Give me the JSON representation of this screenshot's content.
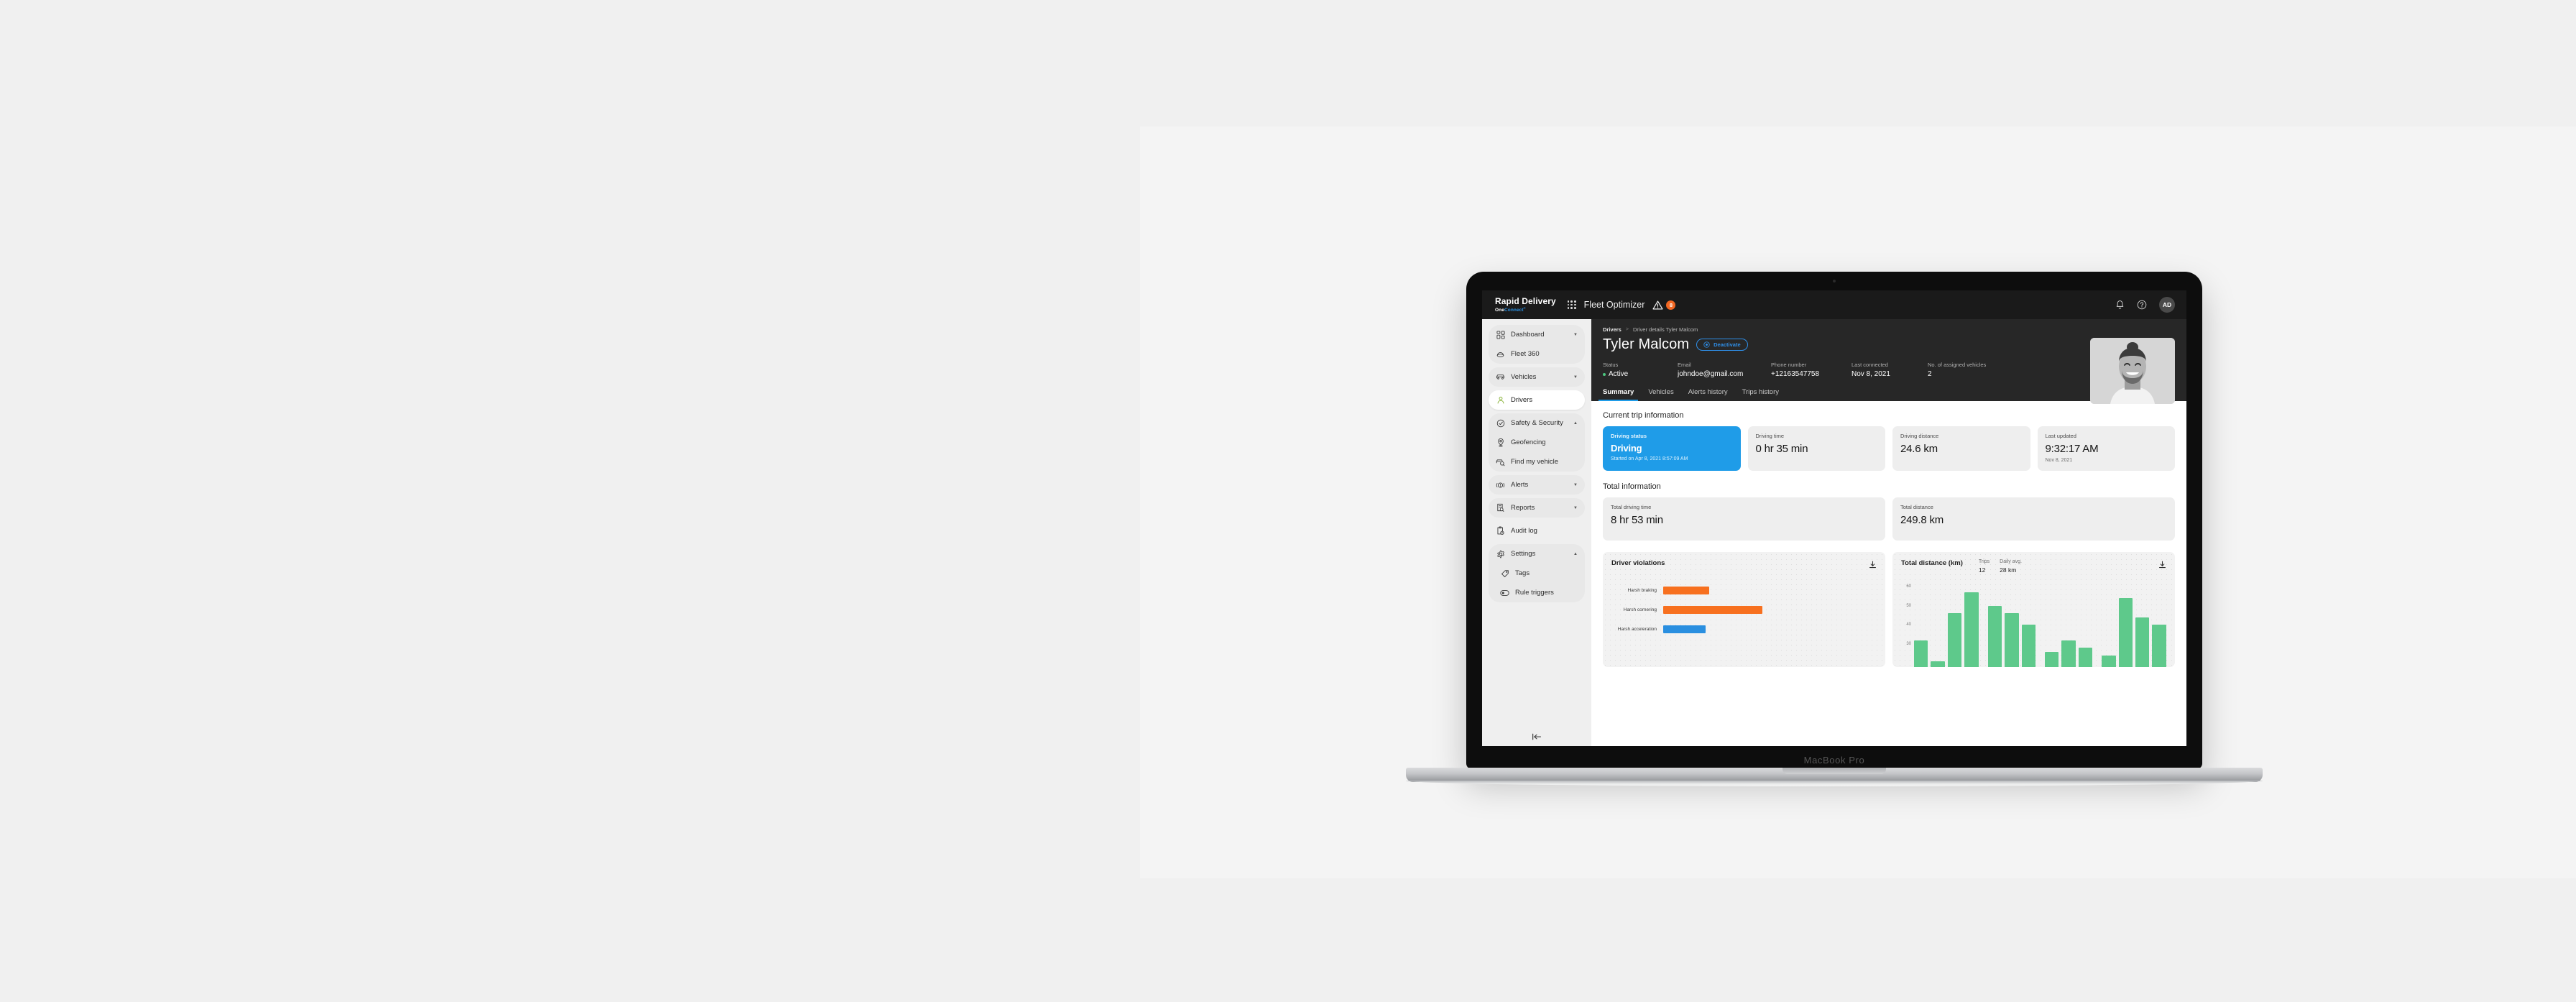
{
  "device": {
    "brand_label": "MacBook Pro"
  },
  "topbar": {
    "logo_main": "Rapid Delivery",
    "logo_sub_one": "One",
    "logo_sub_connect": "Connect",
    "app_name": "Fleet Optimizer",
    "alert_badge_count": "8",
    "user_initials": "AD",
    "icons": {
      "apps_grid": "apps-grid-icon",
      "warning": "warning-triangle-icon",
      "notifications": "bell-icon",
      "help": "help-circle-icon"
    }
  },
  "sidebar": {
    "groups": [
      {
        "items": [
          {
            "label": "Dashboard",
            "icon": "dashboard-icon",
            "caret": "▼",
            "active": false
          },
          {
            "label": "Fleet 360",
            "icon": "fleet360-icon",
            "caret": "",
            "active": false
          }
        ]
      },
      {
        "items": [
          {
            "label": "Vehicles",
            "icon": "car-icon",
            "caret": "▼",
            "active": false
          }
        ]
      },
      {
        "items": [
          {
            "label": "Drivers",
            "icon": "driver-icon",
            "caret": "",
            "active": true
          }
        ]
      },
      {
        "items": [
          {
            "label": "Safety & Security",
            "icon": "shield-check-icon",
            "caret": "▲",
            "active": false
          },
          {
            "label": "Geofencing",
            "icon": "map-pin-icon",
            "caret": "",
            "active": false
          },
          {
            "label": "Find my vehicle",
            "icon": "find-vehicle-icon",
            "caret": "",
            "active": false
          }
        ]
      },
      {
        "items": [
          {
            "label": "Alerts",
            "icon": "alert-bell-icon",
            "caret": "▼",
            "active": false
          }
        ]
      },
      {
        "items": [
          {
            "label": "Reports",
            "icon": "report-search-icon",
            "caret": "▼",
            "active": false
          }
        ]
      },
      {
        "items": [
          {
            "label": "Audit log",
            "icon": "clipboard-clock-icon",
            "caret": "",
            "active": false
          }
        ]
      },
      {
        "items": [
          {
            "label": "Settings",
            "icon": "gear-icon",
            "caret": "▲",
            "active": false
          },
          {
            "label": "Tags",
            "icon": "tag-icon",
            "caret": "",
            "active": false
          },
          {
            "label": "Rule triggers",
            "icon": "toggle-icon",
            "caret": "",
            "active": false
          }
        ]
      }
    ],
    "collapse_icon": "collapse-sidebar-icon"
  },
  "breadcrumb": {
    "root": "Drivers",
    "separator": ">",
    "current": "Driver details Tyler Malcom"
  },
  "driver": {
    "name": "Tyler Malcom",
    "deactivate_label": "Deactivate",
    "meta": [
      {
        "label": "Status",
        "value": "Active",
        "has_dot": true
      },
      {
        "label": "Email",
        "value": "johndoe@gmail.com",
        "has_dot": false
      },
      {
        "label": "Phone number",
        "value": "+12163547758",
        "has_dot": false
      },
      {
        "label": "Last connected",
        "value": "Nov 8, 2021",
        "has_dot": false
      },
      {
        "label": "No. of assigned vehicles",
        "value": "2",
        "has_dot": false
      }
    ],
    "photo_alt": "driver-photo"
  },
  "tabs": [
    {
      "label": "Summary",
      "active": true
    },
    {
      "label": "Vehicles",
      "active": false
    },
    {
      "label": "Alerts history",
      "active": false
    },
    {
      "label": "Trips history",
      "active": false
    }
  ],
  "current_trip": {
    "section_title": "Current trip information",
    "cards": [
      {
        "label": "Driving status",
        "value": "Driving",
        "sub": "Started on Apr 8, 2021 8:57:09 AM",
        "accent": true
      },
      {
        "label": "Driving time",
        "value": "0 hr 35 min",
        "sub": "",
        "accent": false
      },
      {
        "label": "Driving distance",
        "value": "24.6 km",
        "sub": "",
        "accent": false
      },
      {
        "label": "Last updated",
        "value": "9:32:17 AM",
        "sub": "Nov 8, 2021",
        "accent": false
      }
    ]
  },
  "total_info": {
    "section_title": "Total information",
    "cards": [
      {
        "label": "Total driving time",
        "value": "8 hr 53 min"
      },
      {
        "label": "Total distance",
        "value": "249.8 km"
      }
    ]
  },
  "colors": {
    "accent_blue": "#1f9ce8",
    "orange": "#f26722",
    "green": "#5ec98b",
    "status_green": "#4cc77f",
    "link_blue": "#2f8fe8"
  },
  "chart_data": [
    {
      "type": "bar",
      "orientation": "horizontal",
      "title": "Driver violations",
      "xlabel": "",
      "ylabel": "",
      "grid": true,
      "legend": "none",
      "download_icon": "download-icon",
      "categories": [
        "Harsh braking",
        "Harsh cornering",
        "Harsh acceleration"
      ],
      "values": [
        13,
        28,
        12
      ],
      "xlim": [
        0,
        75
      ],
      "colors": [
        "#f7701f",
        "#f7701f",
        "#2a8fe0"
      ]
    },
    {
      "type": "bar",
      "orientation": "vertical",
      "title": "Total distance (km)",
      "xlabel": "",
      "ylabel": "km",
      "grid": true,
      "legend": "none",
      "download_icon": "download-icon",
      "stats": [
        {
          "label": "Trips",
          "value": "12"
        },
        {
          "label": "Daily avg.",
          "value": "28 km"
        }
      ],
      "ytick_labels": [
        "60",
        "50",
        "40",
        "30"
      ],
      "ylim": [
        18,
        63
      ],
      "series": [
        {
          "name": "Total distance",
          "values": [
            32,
            21,
            46,
            57,
            50,
            46,
            40,
            26,
            32,
            28,
            24,
            54,
            44,
            40
          ]
        }
      ],
      "color": "#5ec98b"
    }
  ]
}
